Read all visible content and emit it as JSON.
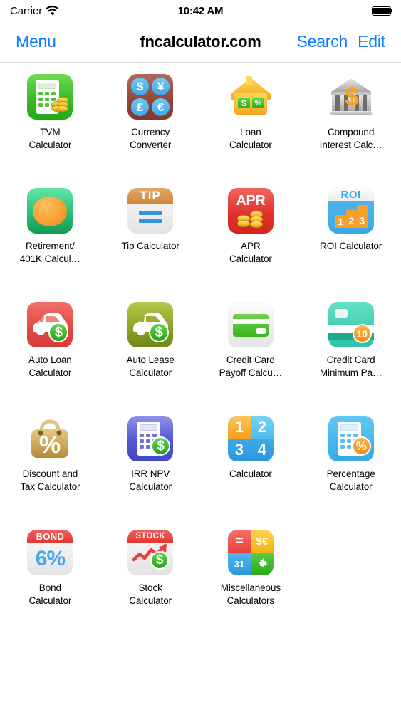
{
  "status_bar": {
    "carrier": "Carrier",
    "wifi_icon": "wifi-icon",
    "time": "10:42 AM",
    "battery_icon": "battery-full-icon"
  },
  "nav_bar": {
    "menu_label": "Menu",
    "title": "fncalculator.com",
    "search_label": "Search",
    "edit_label": "Edit",
    "tint_color": "#0a7cff"
  },
  "grid": {
    "columns": 4,
    "items": [
      {
        "id": "tvm-calculator",
        "label": "TVM\nCalculator",
        "icon": "tvm-calculator-icon",
        "color": "#3fbf2a"
      },
      {
        "id": "currency-converter",
        "label": "Currency\nConverter",
        "icon": "currency-converter-icon",
        "color": "#8e4636",
        "symbols": [
          "$",
          "¥",
          "£",
          "€"
        ]
      },
      {
        "id": "loan-calculator",
        "label": "Loan\nCalculator",
        "icon": "loan-calculator-icon",
        "color": "#f9b933",
        "badges": [
          "$",
          "%"
        ]
      },
      {
        "id": "compound-interest-calculator",
        "label": "Compound\nInterest Calc…",
        "icon": "compound-interest-icon",
        "color": "#b9b9b9",
        "badges": [
          "$"
        ]
      },
      {
        "id": "retirement-401k-calculator",
        "label": "Retirement/\n401K Calcul…",
        "icon": "retirement-401k-icon",
        "color": "#2fc47a"
      },
      {
        "id": "tip-calculator",
        "label": "Tip Calculator",
        "icon": "tip-calculator-icon",
        "color": "#d98b3c",
        "header_text": "TIP"
      },
      {
        "id": "apr-calculator",
        "label": "APR\nCalculator",
        "icon": "apr-calculator-icon",
        "color": "#e0342f",
        "header_text": "APR"
      },
      {
        "id": "roi-calculator",
        "label": "ROI Calculator",
        "icon": "roi-calculator-icon",
        "color": "#3aa8e6",
        "header_text": "ROI",
        "bars": [
          "1",
          "2",
          "3"
        ]
      },
      {
        "id": "auto-loan-calculator",
        "label": "Auto Loan\nCalculator",
        "icon": "auto-loan-icon",
        "color": "#e04a45",
        "badges": [
          "$"
        ]
      },
      {
        "id": "auto-lease-calculator",
        "label": "Auto Lease\nCalculator",
        "icon": "auto-lease-icon",
        "color": "#8a9d26",
        "badges": [
          "$"
        ]
      },
      {
        "id": "credit-card-payoff-calculator",
        "label": "Credit Card\nPayoff Calcu…",
        "icon": "credit-card-payoff-icon",
        "color": "#2db52d"
      },
      {
        "id": "credit-card-minimum-payment",
        "label": "Credit Card\nMinimum Pa…",
        "icon": "credit-card-minimum-icon",
        "color": "#2fc3a6",
        "badges": [
          "10"
        ]
      },
      {
        "id": "discount-tax-calculator",
        "label": "Discount and\nTax Calculator",
        "icon": "discount-tax-icon",
        "color": "#c59a4a",
        "header_text": "%"
      },
      {
        "id": "irr-npv-calculator",
        "label": "IRR NPV\nCalculator",
        "icon": "irr-npv-icon",
        "color": "#5257cf",
        "badges": [
          "$"
        ]
      },
      {
        "id": "calculator",
        "label": "Calculator",
        "icon": "calculator-icon",
        "color": "#2aa6e8",
        "digits": [
          "1",
          "2",
          "3",
          "4"
        ]
      },
      {
        "id": "percentage-calculator",
        "label": "Percentage\nCalculator",
        "icon": "percentage-calculator-icon",
        "color": "#35a9e6",
        "badges": [
          "%"
        ]
      },
      {
        "id": "bond-calculator",
        "label": "Bond\nCalculator",
        "icon": "bond-calculator-icon",
        "color": "#e8403b",
        "header_text": "BOND",
        "body_text": "6%"
      },
      {
        "id": "stock-calculator",
        "label": "Stock\nCalculator",
        "icon": "stock-calculator-icon",
        "color": "#e8403b",
        "header_text": "STOCK",
        "badges": [
          "$"
        ]
      },
      {
        "id": "miscellaneous-calculators",
        "label": "Miscellaneous\nCalculators",
        "icon": "miscellaneous-calculators-icon",
        "color": "#e8524d",
        "symbols": [
          "=",
          "$€",
          "31",
          "gear"
        ]
      }
    ]
  }
}
